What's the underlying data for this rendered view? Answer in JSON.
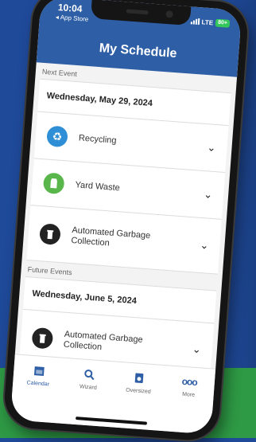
{
  "status_bar": {
    "time": "10:04",
    "back_label": "◂ App Store",
    "network": "LTE",
    "battery": "80+"
  },
  "header": {
    "title": "My Schedule"
  },
  "next_event": {
    "section_label": "Next Event",
    "date": "Wednesday, May 29, 2024",
    "items": [
      {
        "label": "Recycling",
        "icon": "recycle-icon"
      },
      {
        "label": "Yard Waste",
        "icon": "yard-waste-bag-icon"
      },
      {
        "label": "Automated Garbage Collection",
        "icon": "garbage-cart-icon"
      }
    ]
  },
  "future_events": {
    "section_label": "Future Events",
    "date": "Wednesday, June 5, 2024",
    "items": [
      {
        "label": "Automated Garbage Collection",
        "icon": "garbage-cart-icon"
      }
    ]
  },
  "tabs": [
    {
      "label": "Calendar",
      "icon": "calendar-icon",
      "active": true
    },
    {
      "label": "Wizard",
      "icon": "wizard-search-icon",
      "active": false
    },
    {
      "label": "Oversized",
      "icon": "oversized-item-icon",
      "active": false
    },
    {
      "label": "More",
      "icon": "more-icon",
      "active": false
    }
  ],
  "colors": {
    "header": "#2e5ea5",
    "recycle": "#2f8fd6",
    "yard": "#58b64a",
    "background_blue": "#1f4a9a",
    "background_green": "#2e9a45"
  }
}
